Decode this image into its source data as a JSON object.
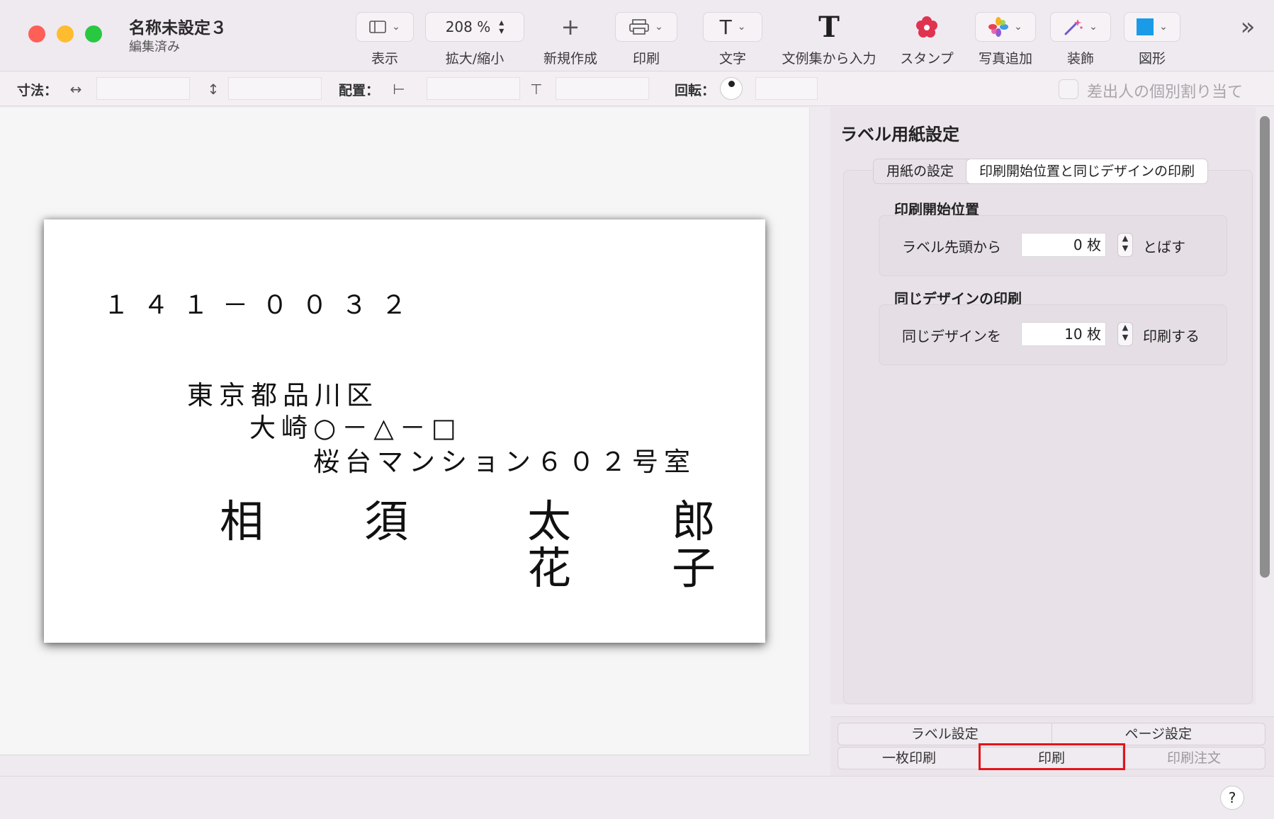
{
  "window": {
    "title": "名称未設定３",
    "subtitle": "編集済み",
    "traffic_lights": {
      "close": "#fe5f57",
      "minimize": "#febc2e",
      "zoom": "#28c840"
    }
  },
  "toolbar": {
    "view_label": "表示",
    "zoom_value": "208 %",
    "zoom_label": "拡大/縮小",
    "new_icon": "+",
    "new_label": "新規作成",
    "print_label": "印刷",
    "text_icon": "T",
    "text_label": "文字",
    "sample_icon": "T",
    "sample_label": "文例集から入力",
    "stamp_label": "スタンプ",
    "photo_label": "写真追加",
    "decor_label": "装飾",
    "shape_label": "図形",
    "more_icon": "»"
  },
  "dimbar": {
    "size_label": "寸法：",
    "position_label": "配置：",
    "rotation_label": "回転：",
    "sender_checkbox_label": "差出人の個別割り当て"
  },
  "label": {
    "postal_code": "１４１－００３２",
    "address_line1": "東京都品川区",
    "address_line2": "大崎○－△－□",
    "address_line3": "桜台マンション６０２号室",
    "surname": "相　須",
    "given_name1": "太　郎",
    "given_name2": "花　子"
  },
  "panel": {
    "title": "ラベル用紙設定",
    "tabs": [
      "用紙の設定",
      "印刷開始位置と同じデザインの印刷"
    ],
    "selected_tab": 1,
    "start_group_title": "印刷開始位置",
    "start_row_label": "ラベル先頭から",
    "start_value": "0 枚",
    "start_suffix": "とばす",
    "design_group_title": "同じデザインの印刷",
    "design_row_label": "同じデザインを",
    "design_value": "10 枚",
    "design_suffix": "印刷する"
  },
  "bottom": {
    "label_settings": "ラベル設定",
    "page_settings": "ページ設定",
    "single_print": "一枚印刷",
    "print": "印刷",
    "print_order": "印刷注文",
    "help": "?"
  },
  "colors": {
    "highlight": "#e3141a",
    "accent": "#1a9be8"
  }
}
